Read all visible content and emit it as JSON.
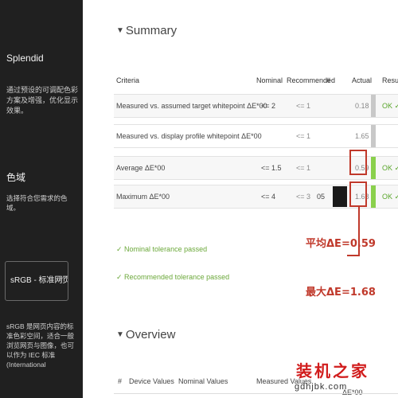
{
  "sidebar": {
    "profile_name": "Splendid",
    "profile_desc": "通过预设的可调配色彩方案及增强，优化显示效果。",
    "gamut_title": "色域",
    "gamut_desc": "选择符合您需求的色域。",
    "gamut_select_value": "sRGB - 标准网页内容色",
    "gamut_footer": "sRGB 是网页内容的标准色彩空间，适合一般浏览网页与图像，也可以作为 IEC 标准 (International"
  },
  "summary": {
    "title": "Summary",
    "headers": [
      "Criteria",
      "Nominal",
      "Recommended",
      "#",
      "Actual",
      "Result"
    ],
    "rows": [
      {
        "criteria": "Measured vs. assumed target whitepoint ΔE*00",
        "nominal": "<= 2",
        "recommended": "<= 1",
        "num": "",
        "actual": "0.18",
        "result": "OK ✓✓"
      },
      {
        "criteria": "Measured vs. display profile whitepoint ΔE*00",
        "nominal": "",
        "recommended": "<= 1",
        "num": "",
        "actual": "1.65",
        "result": ""
      },
      {
        "criteria": "Average ΔE*00",
        "nominal": "<= 1.5",
        "recommended": "<= 1",
        "num": "",
        "actual": "0.59",
        "result": "OK ✓✓"
      },
      {
        "criteria": "Maximum ΔE*00",
        "nominal": "<= 4",
        "recommended": "<= 3",
        "num": "05",
        "actual": "1.68",
        "result": "OK ✓✓"
      }
    ],
    "nominal_passed": "✓ Nominal tolerance passed",
    "recommended_passed": "✓ Recommended tolerance passed"
  },
  "annotations": {
    "avg": "平均ΔE=0.59",
    "max": "最大ΔE=1.68"
  },
  "overview": {
    "title": "Overview",
    "headers": [
      "#",
      "Device Values",
      "Nominal Values",
      "Measured Values",
      "ΔE*00"
    ]
  },
  "watermark": {
    "main": "装机之家",
    "url": "gdhjbk.com"
  },
  "colors": {
    "accent_red": "#c0392b",
    "ok_green": "#5aa62c",
    "bar_green": "#8ad04c"
  }
}
